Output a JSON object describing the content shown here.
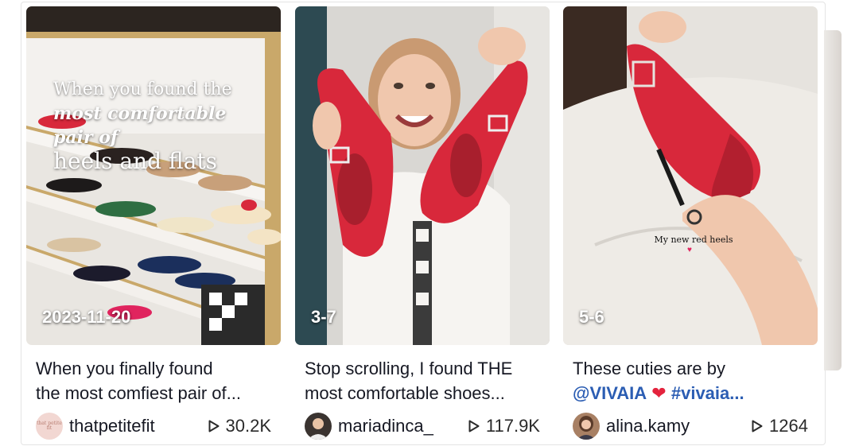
{
  "cards": [
    {
      "badge": "2023-11-20",
      "overlay": {
        "line1": "When you found the",
        "line2": "most comfortable pair of",
        "line3": "heels and flats"
      },
      "desc_line1": "When you finally found",
      "desc_line2": "the most comfiest pair of...",
      "author": "thatpetitefit",
      "avatar_text": "that petite fit",
      "views": "30.2K"
    },
    {
      "badge": "3-7",
      "desc_line1": "Stop scrolling, I found THE",
      "desc_line2": "most comfortable shoes...",
      "author": "mariadinca_",
      "views": "117.9K"
    },
    {
      "badge": "5-6",
      "overlay_caption": "My new red heels",
      "desc_line1": "These cuties are by",
      "mention": "@VIVAIA",
      "hashtag": "#vivaia...",
      "author": "alina.kamy",
      "views": "1264"
    }
  ],
  "icons": {
    "views": "play-icon",
    "heart": "heart-emoji"
  },
  "colors": {
    "text": "#161823",
    "hashtag": "#2b5db3",
    "heart": "#e4233d",
    "shoe_red": "#d8283b"
  }
}
